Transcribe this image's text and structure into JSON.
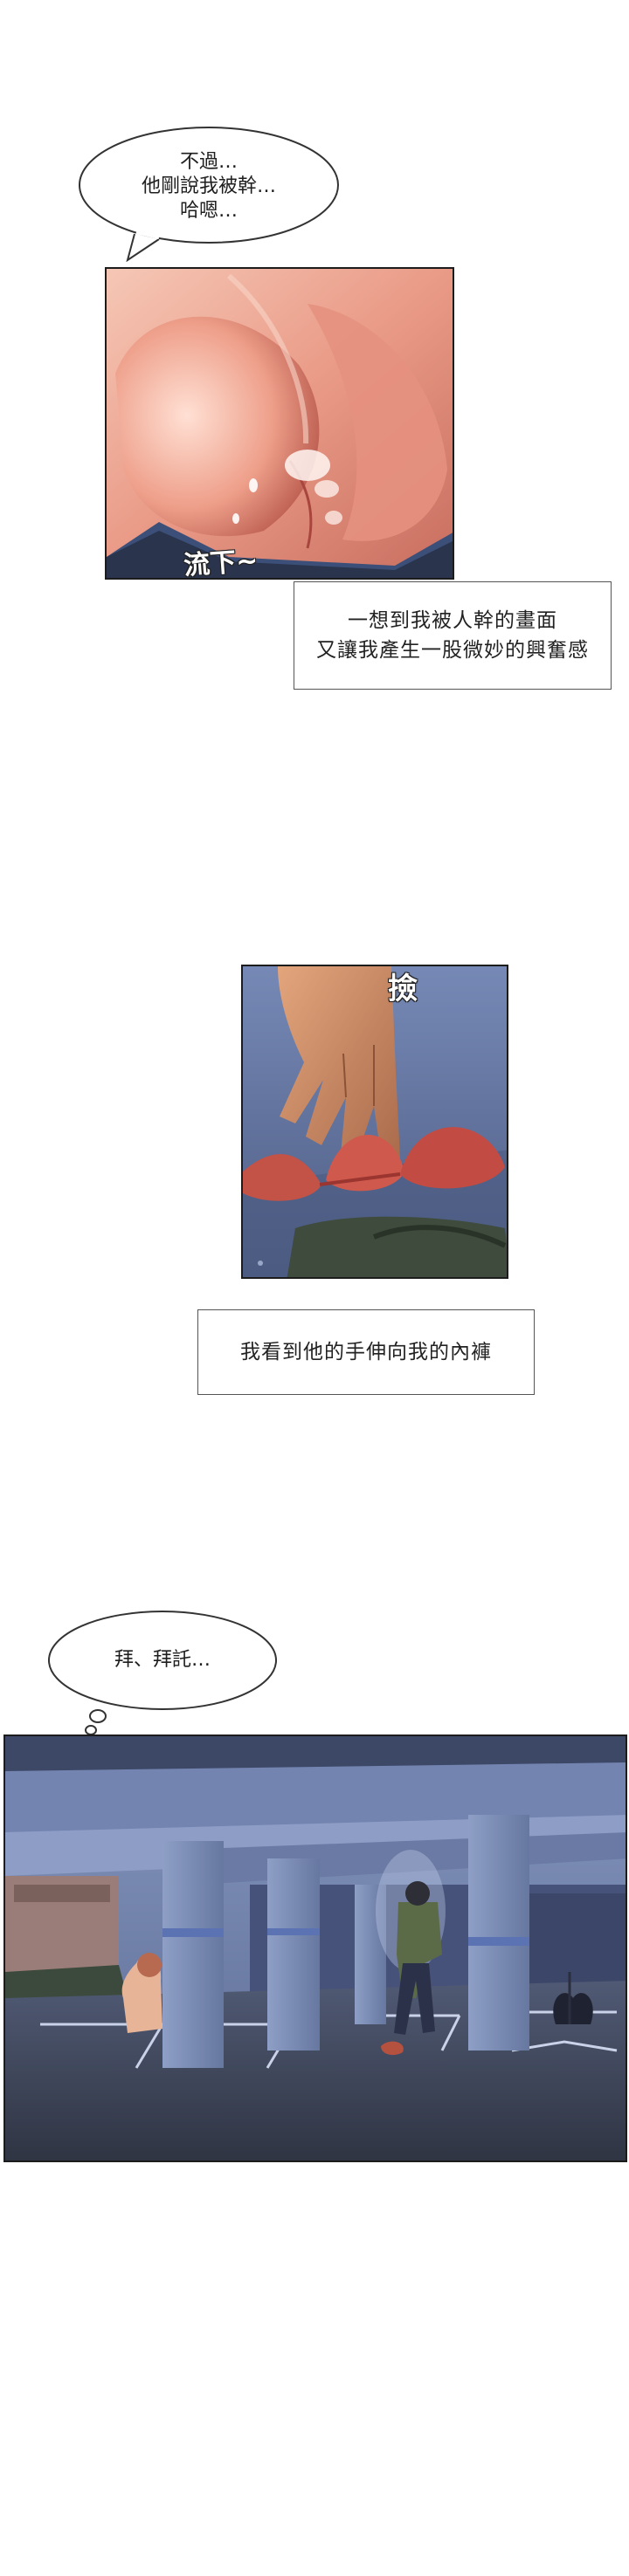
{
  "bubble1": {
    "lines": [
      "不過…",
      "他剛說我被幹…",
      "哈嗯…"
    ]
  },
  "panel1": {
    "sfx": "流下~"
  },
  "caption1": {
    "lines": [
      "一想到我被人幹的畫面",
      "又讓我產生一股微妙的興奮感"
    ]
  },
  "panel2": {
    "sfx": "撿"
  },
  "caption2": {
    "text": "我看到他的手伸向我的內褲"
  },
  "bubble2": {
    "text": "拜、拜託…"
  },
  "colors": {
    "skin": "#e9a493",
    "night_blue": "#5d6d93",
    "parking_floor": "#3a3f4c",
    "bubble_border": "#333333"
  }
}
